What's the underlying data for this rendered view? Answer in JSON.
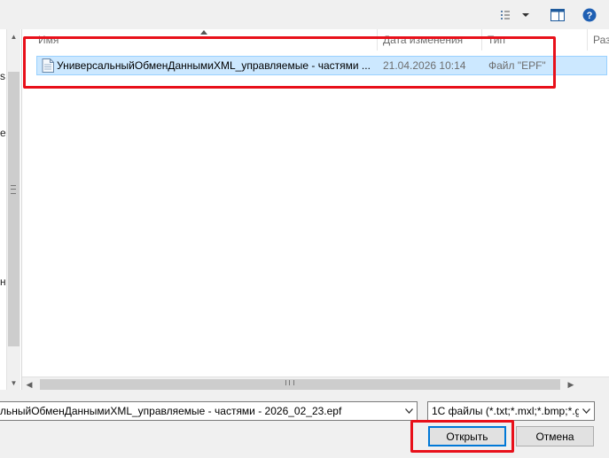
{
  "left_pane": {
    "fragments": [
      "s",
      "e",
      "н"
    ]
  },
  "file_list": {
    "columns": [
      {
        "label": "Имя"
      },
      {
        "label": "Дата изменения"
      },
      {
        "label": "Тип"
      },
      {
        "label": "Раз"
      }
    ],
    "rows": [
      {
        "name": "УниверсальныйОбменДаннымиXML_управляемые - частями ...",
        "date": "21.04.2026 10:14",
        "type": "Файл \"EPF\""
      }
    ]
  },
  "bottom": {
    "filename_value": "льныйОбменДаннымиXML_управляемые - частями - 2026_02_23.epf",
    "filter_value": "1С файлы (*.txt;*.mxl;*.bmp;*.g",
    "open_label": "Открыть",
    "cancel_label": "Отмена"
  },
  "colors": {
    "selection_bg": "#cce8ff",
    "selection_border": "#99d1ff",
    "annotation_red": "#e8101a",
    "accent_blue": "#0078d7"
  },
  "icons": [
    "view-options-icon",
    "chevron-down-icon",
    "preview-pane-icon",
    "help-icon",
    "file-icon"
  ]
}
